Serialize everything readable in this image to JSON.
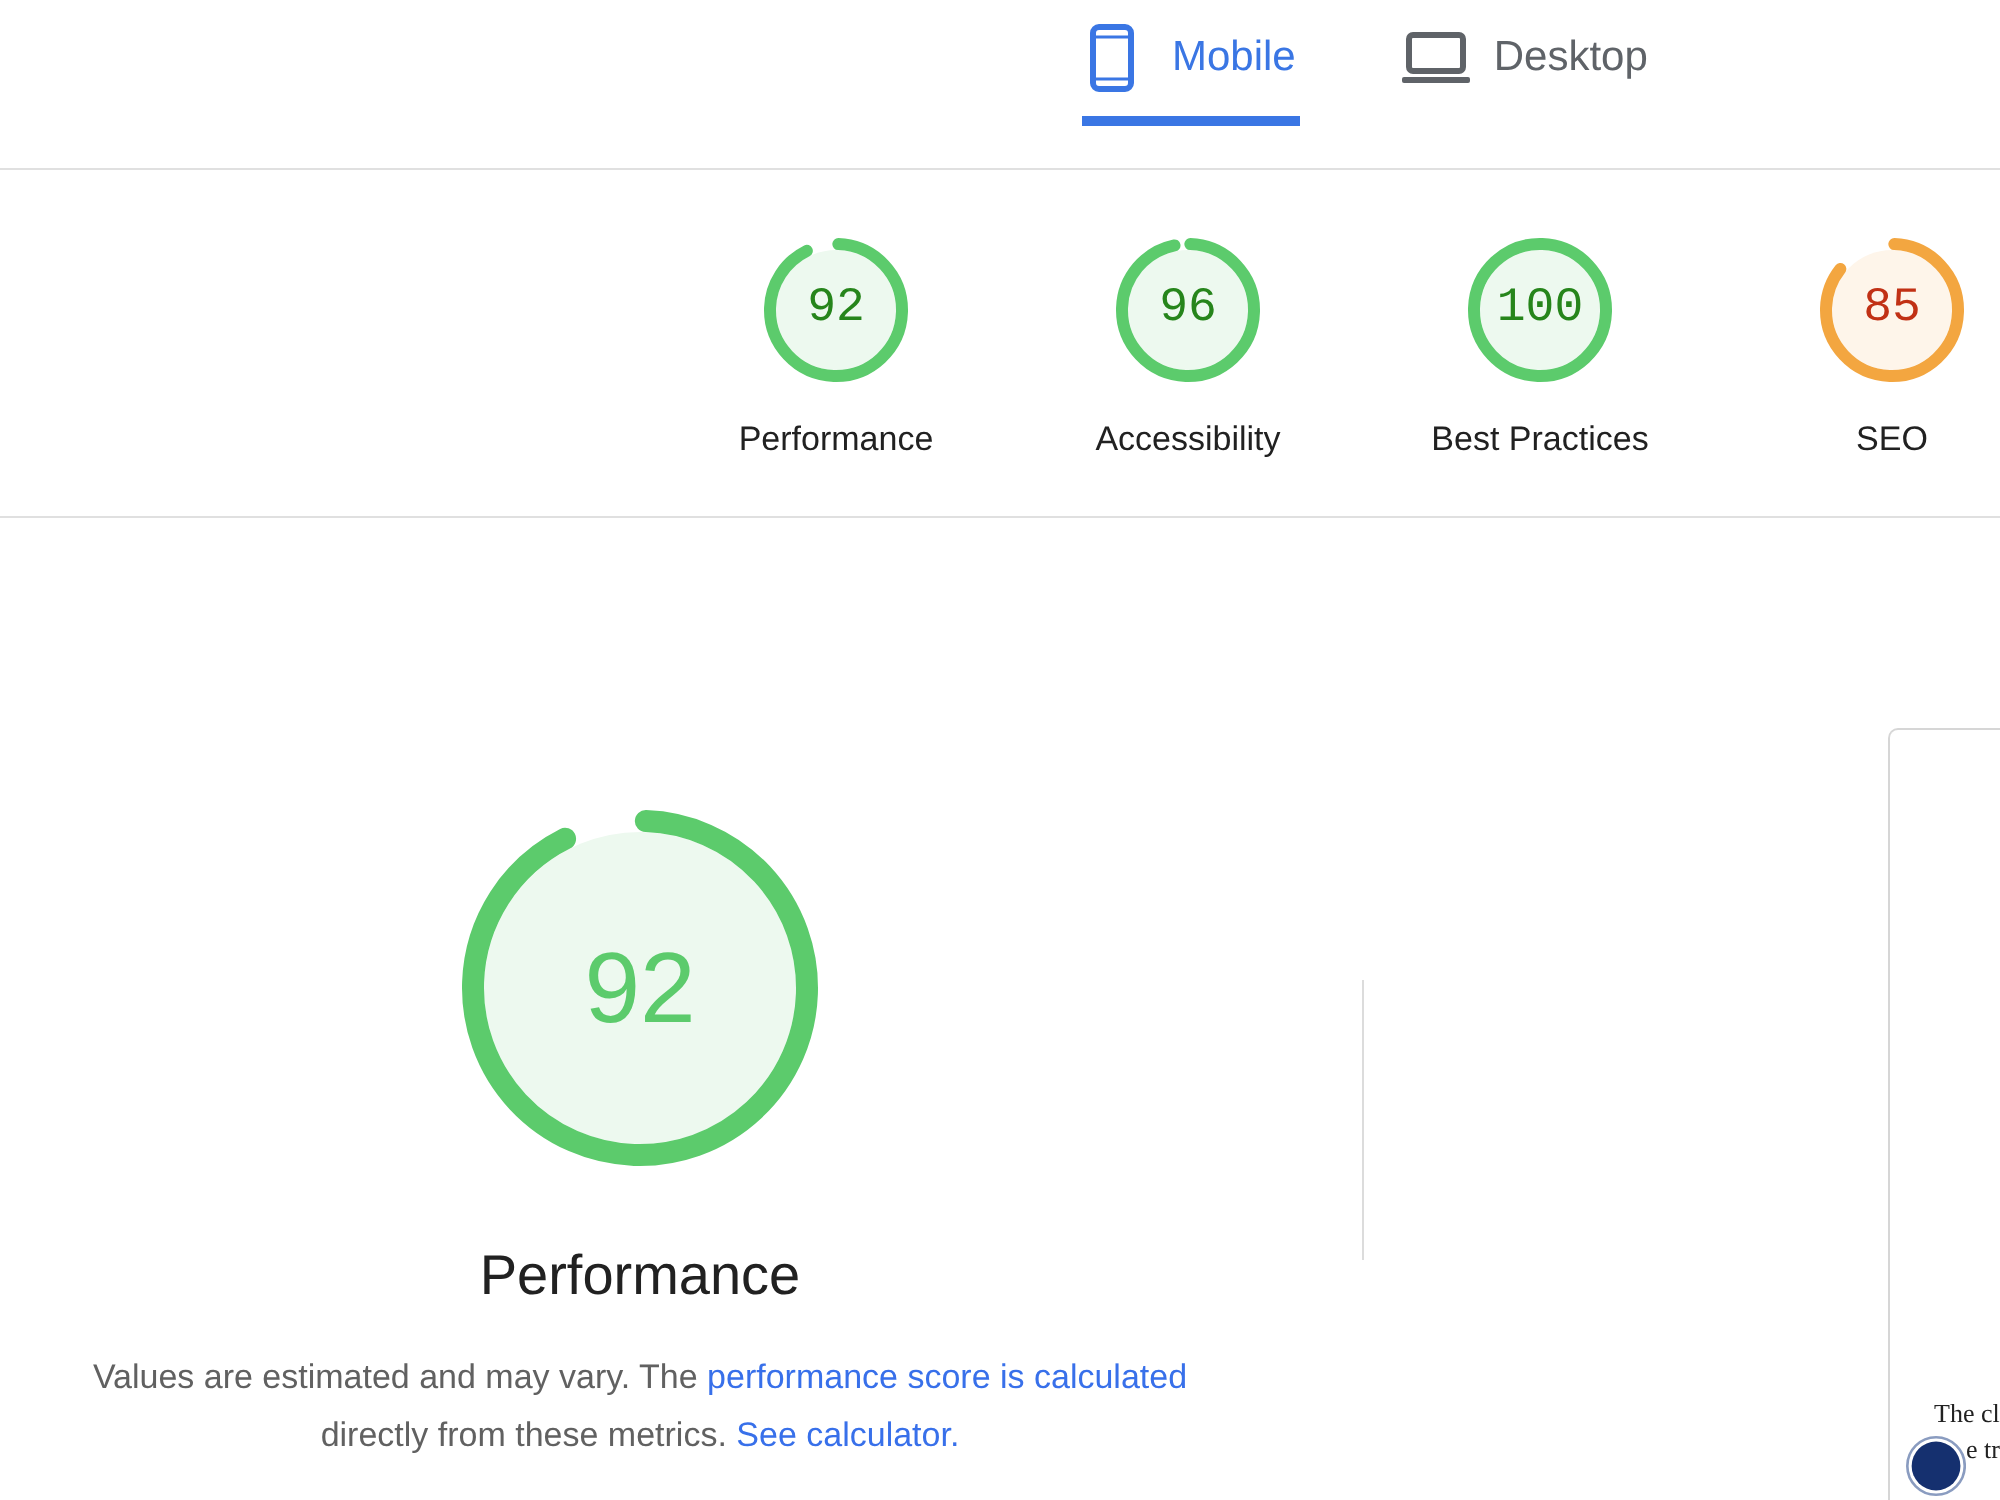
{
  "tabs": [
    {
      "label": "Mobile",
      "kind": "phone",
      "selected": true
    },
    {
      "label": "Desktop",
      "kind": "laptop",
      "selected": false
    }
  ],
  "gauges": [
    {
      "score": "92",
      "label": "Performance",
      "level": 0.92,
      "color": "#5ccb6c"
    },
    {
      "score": "96",
      "label": "Accessibility",
      "level": 0.96,
      "color": "#5ccb6c"
    },
    {
      "score": "100",
      "label": "Best Practices",
      "level": 1,
      "color": "#5ccb6c"
    },
    {
      "score": "85",
      "label": "SEO",
      "level": 0.85,
      "color": "#f3a640"
    }
  ],
  "performance": {
    "score": "92",
    "level": 0.92,
    "color": "#5ccb6c",
    "title": "Performance",
    "description": [
      {
        "kind": "text",
        "text": "Values are estimated and may vary. The "
      },
      {
        "kind": "link",
        "text": "performance score is calculated"
      },
      {
        "kind": "text",
        "text": " directly from these metrics. "
      },
      {
        "kind": "link",
        "text": "See calculator."
      }
    ]
  },
  "screenshot": {
    "lines": [
      "The cl",
      "e tr"
    ]
  }
}
